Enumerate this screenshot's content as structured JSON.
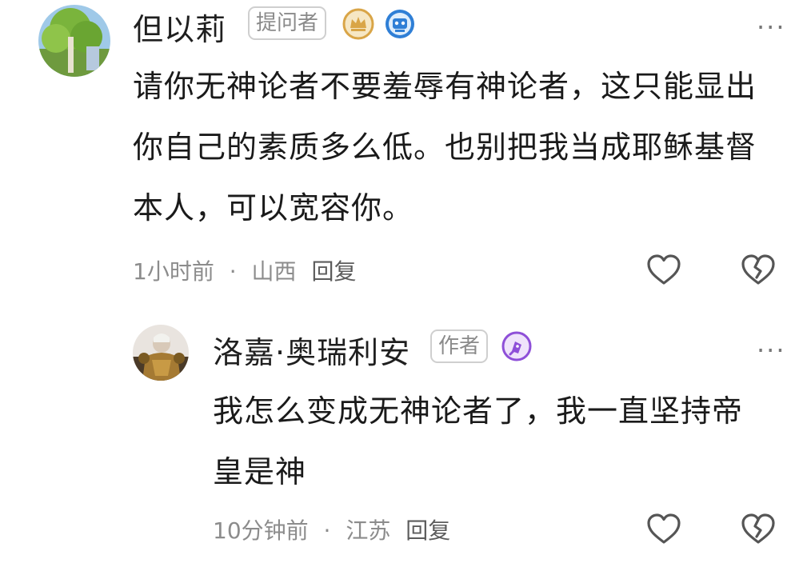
{
  "comments": [
    {
      "author": "但以莉",
      "tag": "提问者",
      "badges": [
        "crown-badge-icon",
        "robot-badge-icon"
      ],
      "text": "请你无神论者不要羞辱有神论者，这只能显出你自己的素质多么低。也别把我当成耶稣基督本人，可以宽容你。",
      "time": "1小时前",
      "separator": "·",
      "location": "山西",
      "reply": "回复",
      "avatar": "tree-avatar"
    },
    {
      "author": "洛嘉·奥瑞利安",
      "tag": "作者",
      "badges": [
        "pen-badge-icon"
      ],
      "text": "我怎么变成无神论者了，我一直坚持帝皇是神",
      "time": "10分钟前",
      "separator": "·",
      "location": "江苏",
      "reply": "回复",
      "avatar": "armored-figure-avatar"
    }
  ],
  "icons": {
    "like": "heart-icon",
    "dislike": "broken-heart-icon",
    "more": "more-icon"
  },
  "colors": {
    "crown_badge": "#d9a547",
    "robot_badge": "#2f7fd6",
    "pen_badge": "#8e4fd8",
    "meta_text": "#8c8c8c"
  }
}
